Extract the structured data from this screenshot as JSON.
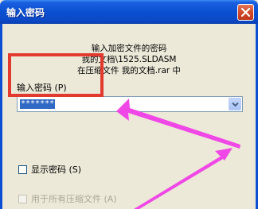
{
  "dialog": {
    "title": "输入密码",
    "message": {
      "line1": "输入加密文件的密码",
      "line2": "我的文档\\1525.SLDASM",
      "line3": "在压缩文件 我的文档.rar 中"
    },
    "password_label": "输入密码 (P)",
    "password_value": "*******",
    "show_password_label": "显示密码 (S)",
    "all_archives_label": "用于所有压缩文件 (A)"
  },
  "annotation": {
    "highlight_color": "#e23a2f",
    "arrow_color": "#f048e6"
  }
}
